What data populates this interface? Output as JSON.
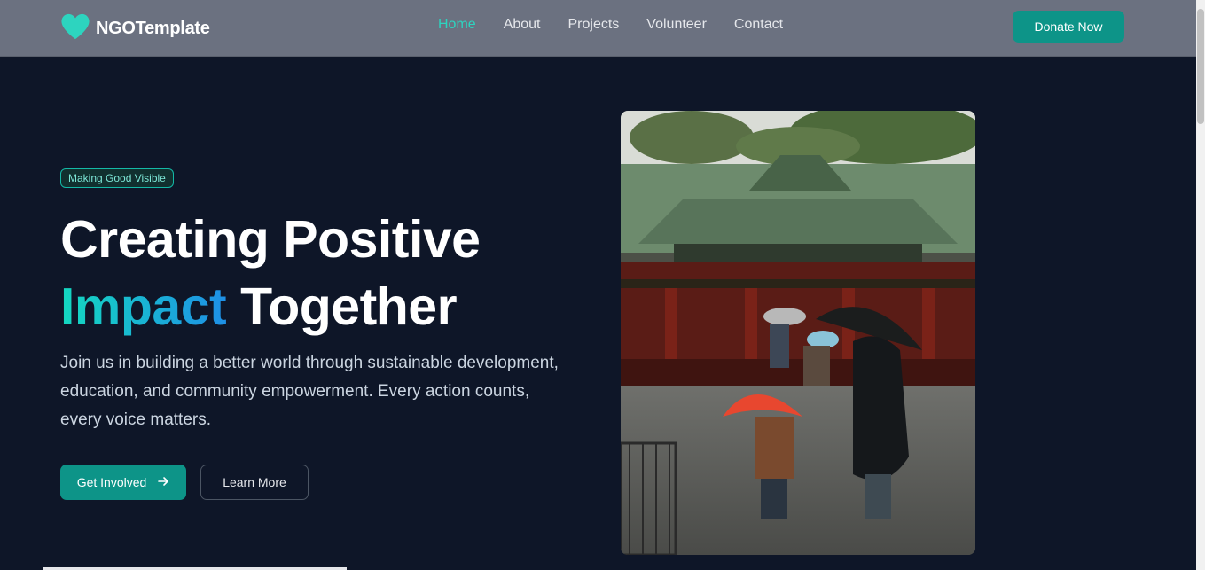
{
  "nav": {
    "logo_icon": "heart-icon",
    "logo_text": "NGOTemplate",
    "links": [
      {
        "label": "Home",
        "active": true
      },
      {
        "label": "About",
        "active": false
      },
      {
        "label": "Projects",
        "active": false
      },
      {
        "label": "Volunteer",
        "active": false
      },
      {
        "label": "Contact",
        "active": false
      }
    ],
    "donate_label": "Donate Now"
  },
  "hero": {
    "badge": "Making Good Visible",
    "title_line1": "Creating Positive",
    "title_highlight": "Impact",
    "title_rest": " Together",
    "description": "Join us in building a better world through sustainable development, education, and community empowerment. Every action counts, every voice matters.",
    "primary_button": "Get Involved",
    "primary_icon": "arrow-right-icon",
    "secondary_button": "Learn More"
  },
  "colors": {
    "accent": "#0d9488",
    "accent_light": "#2dd4bf",
    "background": "#0e1628",
    "navbar": "#6b7180"
  }
}
